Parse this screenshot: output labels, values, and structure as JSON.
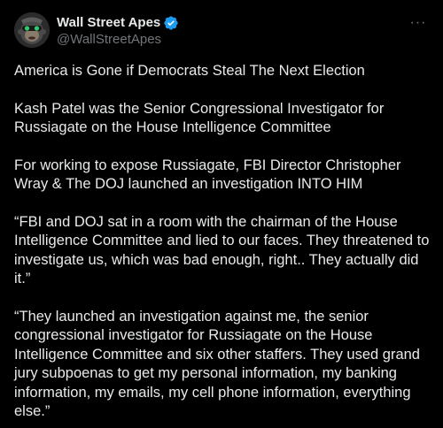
{
  "account": {
    "display_name": "Wall Street Apes",
    "handle": "@WallStreetApes",
    "verified_color": "#1d9bf0"
  },
  "menu": {
    "more_label": "···"
  },
  "icons": {
    "avatar": "ape-avatar",
    "verified": "verified-badge-icon",
    "more": "more-options-icon"
  },
  "post": {
    "paragraphs": [
      "America is Gone if Democrats Steal The Next Election",
      "Kash Patel was the Senior Congressional Investigator for Russiagate on the House Intelligence Committee",
      "For working to expose Russiagate, FBI Director Christopher Wray & The DOJ launched an investigation INTO HIM",
      "“FBI and DOJ sat in a room with the chairman of the House Intelligence Committee and lied to our faces. They threatened to investigate us, which was bad enough, right.. They actually did it.”",
      "“They launched an investigation against me, the senior congressional investigator for Russiagate on the House Intelligence Committee and six other staffers. They used grand jury subpoenas to get my personal information, my banking information, my emails, my cell phone information, everything else.”"
    ]
  }
}
